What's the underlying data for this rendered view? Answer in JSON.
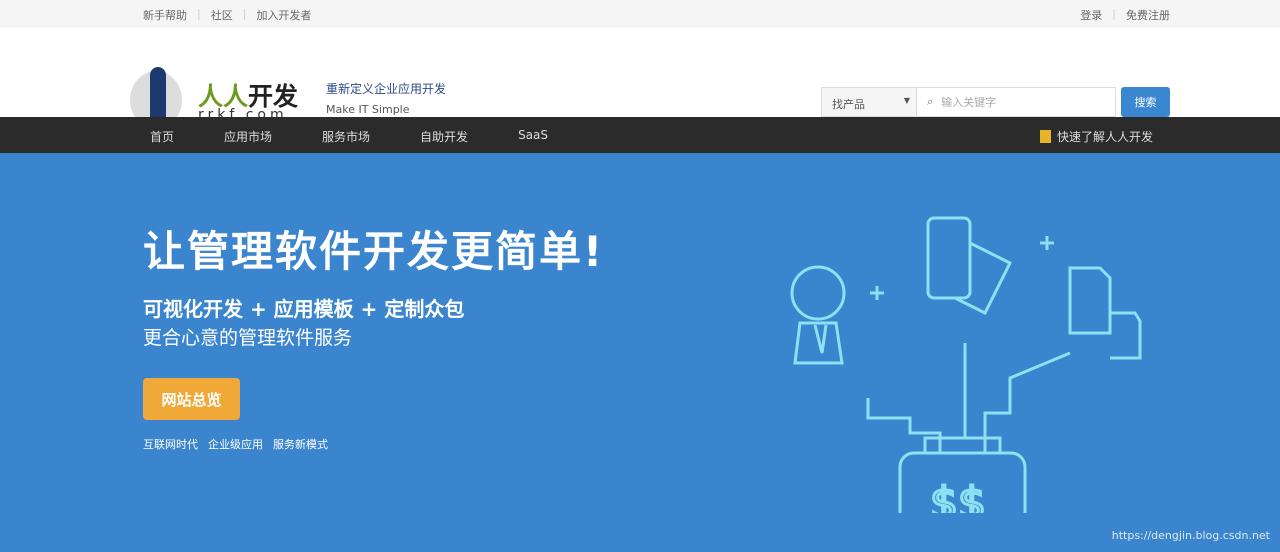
{
  "topbar": {
    "left": [
      "新手帮助",
      "社区",
      "加入开发者"
    ],
    "right": [
      "登录",
      "免费注册"
    ]
  },
  "header": {
    "brand": "人人开发",
    "brand_accent": "人人",
    "brand_rest": "开发",
    "domain": "rrkf.com",
    "slogan_cn": "重新定义企业应用开发",
    "slogan_en": "Make IT Simple"
  },
  "search": {
    "select": "找产品",
    "placeholder": "输入关键字",
    "button": "搜索"
  },
  "nav": {
    "items": [
      "首页",
      "应用市场",
      "服务市场",
      "自助开发",
      "SaaS"
    ],
    "quick": "快速了解人人开发"
  },
  "hero": {
    "title": "让管理软件开发更简单!",
    "subtitle": "可视化开发 + 应用模板 + 定制众包",
    "desc": "更合心意的管理软件服务",
    "button": "网站总览",
    "tags": [
      "互联网时代",
      "企业级应用",
      "服务新模式"
    ]
  },
  "watermark": "https://dengjin.blog.csdn.net"
}
